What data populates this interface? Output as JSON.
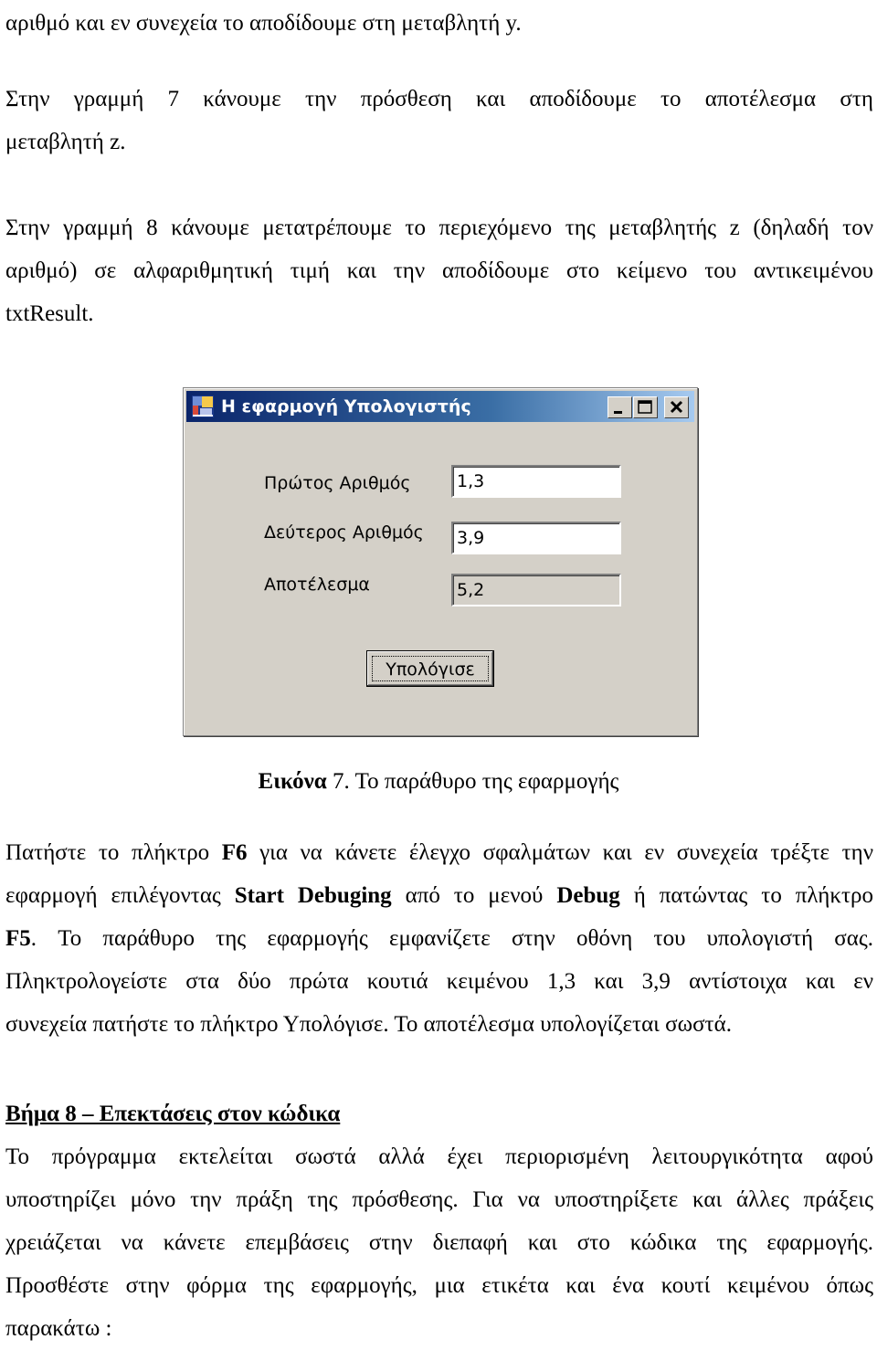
{
  "doc": {
    "p1": {
      "lines": [
        "αριθμό και εν συνεχεία το αποδίδουμε στη μεταβλητή y."
      ]
    },
    "p2": {
      "lines": [
        "Στην γραμμή 7 κάνουμε την πρόσθεση και αποδίδουμε το αποτέλεσμα στη",
        "μεταβλητή z."
      ]
    },
    "p3": {
      "lines": [
        "Στην γραμμή 8 κάνουμε μετατρέπουμε το περιεχόμενο της μεταβλητής z (δηλαδή τον",
        "αριθμό) σε αλφαριθμητική τιμή και την αποδίδουμε στο κείμενο του αντικειμένου",
        "txtResult."
      ]
    },
    "caption": {
      "bold": "Εικόνα",
      "number": "7",
      "text": ". Το παράθυρο της εφαρμογής"
    },
    "p4": {
      "l1a": "Πατήστε το πλήκτρο ",
      "l1b": "F6",
      "l1c": " για να κάνετε έλεγχο σφαλμάτων και εν συνεχεία τρέξτε την",
      "l2a": "εφαρμογή επιλέγοντας ",
      "l2b": "Start Debuging",
      "l2c": " από το μενού ",
      "l2d": "Debug",
      "l2e": " ή πατώντας το πλήκτρο",
      "l3a": "F5",
      "l3b": ".  Το παράθυρο της εφαρμογής εμφανίζετε στην οθόνη του υπολογιστή σας.",
      "l4": "Πληκτρολογείστε στα δύο πρώτα κουτιά κειμένου 1,3 και 3,9 αντίστοιχα και εν",
      "l5": "συνεχεία πατήστε το πλήκτρο Υπολόγισε. Το αποτέλεσμα υπολογίζεται σωστά."
    },
    "heading": "Βήμα 8 – Επεκτάσεις στον κώδικα",
    "p5": {
      "lines": [
        "Το πρόγραμμα εκτελείται σωστά αλλά έχει περιορισμένη λειτουργικότητα αφού",
        "υποστηρίζει μόνο την πράξη της πρόσθεσης. Για να υποστηρίξετε και άλλες πράξεις",
        "χρειάζεται να κάνετε επεμβάσεις στην διεπαφή και στο κώδικα της εφαρμογής.",
        "Προσθέστε στην φόρμα της εφαρμογής, μια ετικέτα και ένα κουτί κειμένου όπως",
        "παρακάτω :"
      ]
    }
  },
  "window": {
    "title": "Η εφαρμογή Υπολογιστής",
    "icon": "app-form-icon",
    "controls": [
      "minimize-icon",
      "maximize-icon",
      "close-icon"
    ],
    "fields": [
      {
        "label": "Πρώτος Αριθμός",
        "value": "1,3",
        "readonly": false
      },
      {
        "label": "Δεύτερος Αριθμός",
        "value": "3,9",
        "readonly": false
      },
      {
        "label": "Αποτέλεσμα",
        "value": "5,2",
        "readonly": true
      }
    ],
    "button_label": "Υπολόγισε",
    "colors": {
      "face": "#d4d0c8",
      "title_start": "#0a246a",
      "title_end": "#a6caf0"
    }
  }
}
